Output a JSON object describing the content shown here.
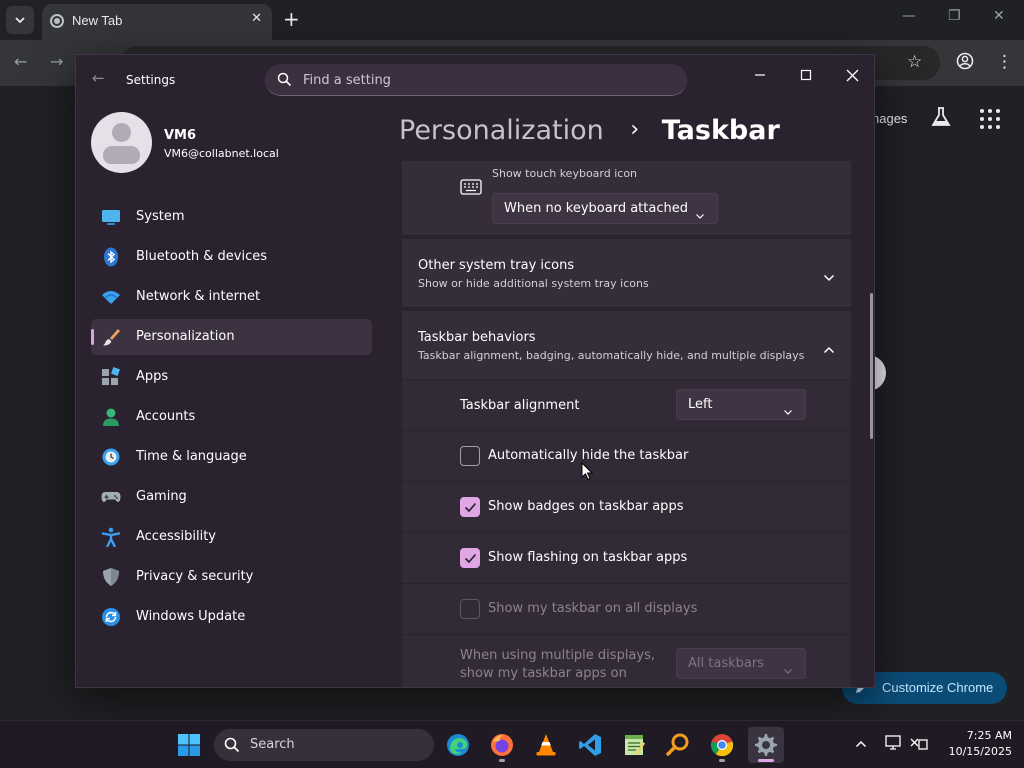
{
  "browser": {
    "tab_title": "New Tab",
    "page_link_text": "nages",
    "customize_button": "Customize Chrome"
  },
  "settings": {
    "app_title": "Settings",
    "search_placeholder": "Find a setting",
    "user": {
      "name": "VM6",
      "email": "VM6@collabnet.local"
    },
    "nav_items": [
      {
        "label": "System",
        "icon": "system-icon"
      },
      {
        "label": "Bluetooth & devices",
        "icon": "bluetooth-icon"
      },
      {
        "label": "Network & internet",
        "icon": "wifi-icon"
      },
      {
        "label": "Personalization",
        "icon": "brush-icon",
        "selected": true
      },
      {
        "label": "Apps",
        "icon": "apps-icon"
      },
      {
        "label": "Accounts",
        "icon": "accounts-icon"
      },
      {
        "label": "Time & language",
        "icon": "time-language-icon"
      },
      {
        "label": "Gaming",
        "icon": "gamepad-icon"
      },
      {
        "label": "Accessibility",
        "icon": "accessibility-icon"
      },
      {
        "label": "Privacy & security",
        "icon": "shield-icon"
      },
      {
        "label": "Windows Update",
        "icon": "update-icon"
      }
    ],
    "breadcrumb": {
      "parent": "Personalization",
      "separator": "›",
      "current": "Taskbar"
    },
    "touch_keyboard": {
      "desc": "Show touch keyboard icon",
      "value": "When no keyboard attached"
    },
    "other_tray_icons": {
      "title": "Other system tray icons",
      "desc": "Show or hide additional system tray icons"
    },
    "taskbar_behaviors": {
      "title": "Taskbar behaviors",
      "desc": "Taskbar alignment, badging, automatically hide, and multiple displays",
      "alignment_label": "Taskbar alignment",
      "alignment_value": "Left",
      "auto_hide": {
        "label": "Automatically hide the taskbar",
        "checked": false
      },
      "show_badges": {
        "label": "Show badges on taskbar apps",
        "checked": true
      },
      "show_flashing": {
        "label": "Show flashing on taskbar apps",
        "checked": true
      },
      "all_displays": {
        "label": "Show my taskbar on all displays",
        "checked": false,
        "disabled": true
      },
      "multi_display_label_line1": "When using multiple displays,",
      "multi_display_label_line2": "show my taskbar apps on",
      "multi_display_value": "All taskbars"
    }
  },
  "taskbar": {
    "search_label": "Search",
    "time": "7:25 AM",
    "date": "10/15/2025"
  },
  "colors": {
    "accent": "#e0a6e6",
    "window_bg": "#2b2230",
    "card_bg": "#362d3b",
    "taskbar_bg": "#1f1a24"
  }
}
